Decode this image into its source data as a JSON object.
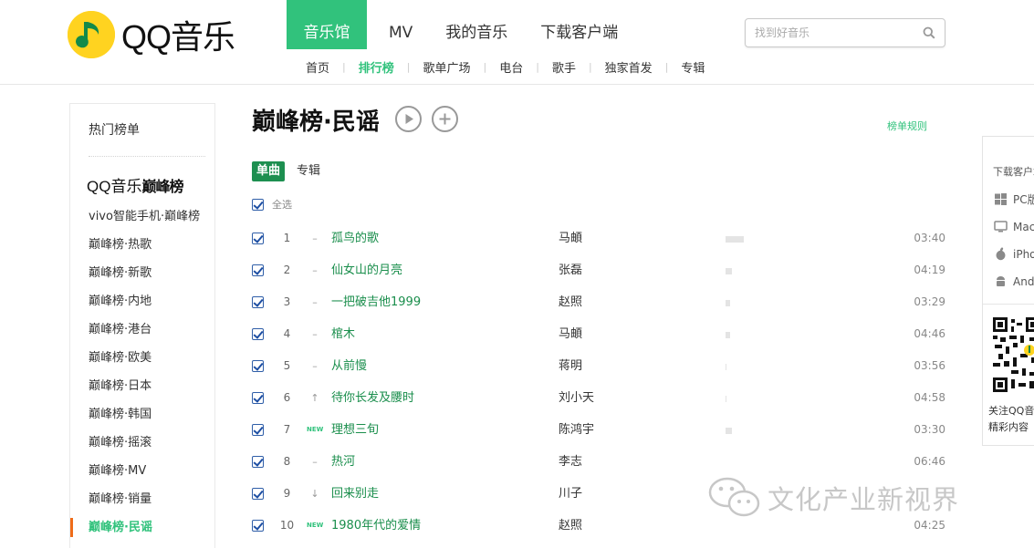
{
  "brand": {
    "name": "QQ音乐",
    "accent_color": "#31c27c",
    "logo_color": "#ffd320"
  },
  "nav": {
    "items": [
      "音乐馆",
      "MV",
      "我的音乐",
      "下载客户端"
    ],
    "active": "音乐馆"
  },
  "search": {
    "placeholder": "找到好音乐",
    "icon": "search-icon"
  },
  "subnav": {
    "items": [
      "首页",
      "排行榜",
      "歌单广场",
      "电台",
      "歌手",
      "独家首发",
      "专辑"
    ],
    "active": "排行榜"
  },
  "sidebar": {
    "hot_title": "热门榜单",
    "group_title_prefix": "QQ音乐",
    "group_title_suffix": "巅峰榜",
    "items": [
      "vivo智能手机·巅峰榜",
      "巅峰榜·热歌",
      "巅峰榜·新歌",
      "巅峰榜·内地",
      "巅峰榜·港台",
      "巅峰榜·欧美",
      "巅峰榜·日本",
      "巅峰榜·韩国",
      "巅峰榜·摇滚",
      "巅峰榜·MV",
      "巅峰榜·销量",
      "巅峰榜·民谣"
    ],
    "active_index": 11,
    "active_marker_color": "#ef6c19"
  },
  "main": {
    "title": "巅峰榜·民谣",
    "play_icon": "play-circle-icon",
    "add_icon": "plus-circle-icon",
    "rule_link": "榜单规则",
    "tabs": [
      "单曲",
      "专辑"
    ],
    "active_tab": "单曲",
    "select_all_label": "全选",
    "songs": [
      {
        "rank": "1",
        "trend": "–",
        "title": "孤鸟的歌",
        "singer": "马頔",
        "popularity": 0.15,
        "duration": "03:40"
      },
      {
        "rank": "2",
        "trend": "–",
        "title": "仙女山的月亮",
        "singer": "张磊",
        "popularity": 0.05,
        "duration": "04:19"
      },
      {
        "rank": "3",
        "trend": "–",
        "title": "一把破吉他1999",
        "singer": "赵照",
        "popularity": 0.04,
        "duration": "03:29"
      },
      {
        "rank": "4",
        "trend": "–",
        "title": "棺木",
        "singer": "马頔",
        "popularity": 0.04,
        "duration": "04:46"
      },
      {
        "rank": "5",
        "trend": "–",
        "title": "从前慢",
        "singer": "蒋明",
        "popularity": 0.01,
        "duration": "03:56"
      },
      {
        "rank": "6",
        "trend": "↑",
        "title": "待你长发及腰时",
        "singer": "刘小天",
        "popularity": 0.01,
        "duration": "04:58"
      },
      {
        "rank": "7",
        "trend": "NEW",
        "title": "理想三旬",
        "singer": "陈鸿宇",
        "popularity": 0.05,
        "duration": "03:30"
      },
      {
        "rank": "8",
        "trend": "–",
        "title": "热河",
        "singer": "李志",
        "popularity": 0.0,
        "duration": "06:46"
      },
      {
        "rank": "9",
        "trend": "↓",
        "title": "回来别走",
        "singer": "川子",
        "popularity": 0.0,
        "duration": ""
      },
      {
        "rank": "10",
        "trend": "NEW",
        "title": "1980年代的爱情",
        "singer": "赵照",
        "popularity": 0.0,
        "duration": "04:25"
      }
    ]
  },
  "right_panel": {
    "download_title": "下载客户端",
    "platforms": [
      {
        "label": "PC版",
        "icon": "windows-icon"
      },
      {
        "label": "Mac版",
        "icon": "mac-icon"
      },
      {
        "label": "iPhone版",
        "icon": "apple-icon"
      },
      {
        "label": "Android版",
        "icon": "android-icon"
      }
    ],
    "qr_icon": "qr-code-icon",
    "follow_line1": "关注QQ音乐",
    "follow_line2": "精彩内容"
  },
  "watermark": {
    "text": "文化产业新视界",
    "icon": "wechat-icon"
  }
}
